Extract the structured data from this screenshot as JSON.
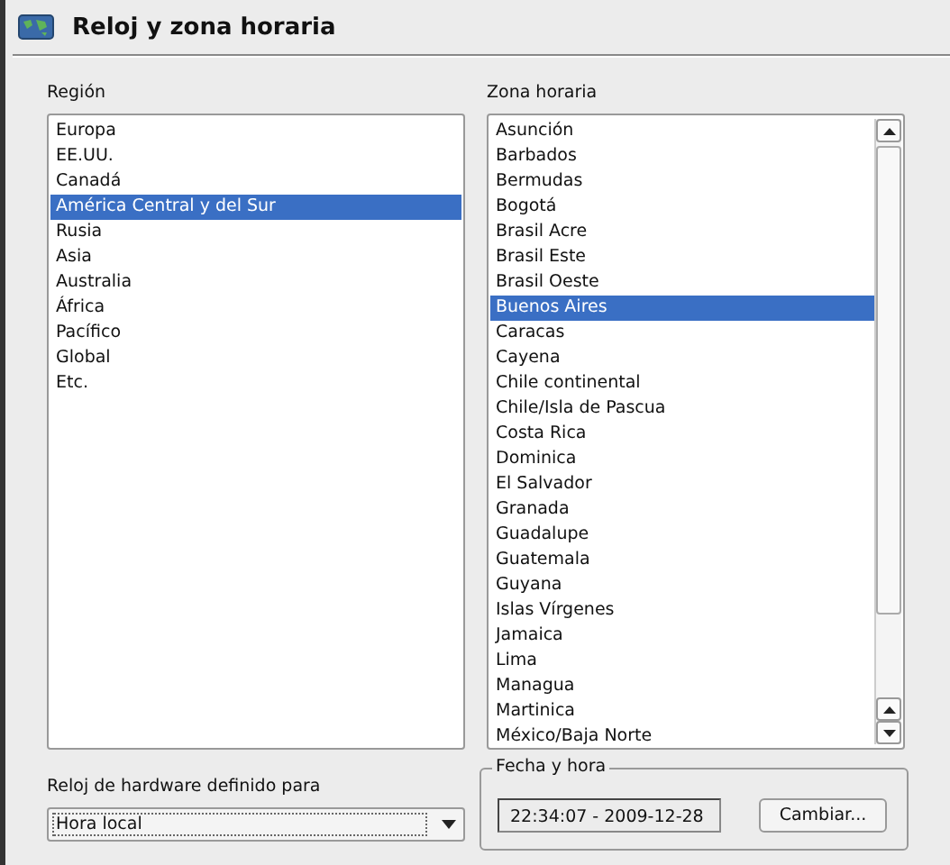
{
  "window": {
    "title": "Reloj y zona horaria"
  },
  "region": {
    "label": "Región",
    "items": [
      {
        "label": "Europa",
        "selected": false
      },
      {
        "label": "EE.UU.",
        "selected": false
      },
      {
        "label": "Canadá",
        "selected": false
      },
      {
        "label": "América Central y del Sur",
        "selected": true
      },
      {
        "label": "Rusia",
        "selected": false
      },
      {
        "label": "Asia",
        "selected": false
      },
      {
        "label": "Australia",
        "selected": false
      },
      {
        "label": "África",
        "selected": false
      },
      {
        "label": "Pacífico",
        "selected": false
      },
      {
        "label": "Global",
        "selected": false
      },
      {
        "label": "Etc.",
        "selected": false
      }
    ]
  },
  "timezone": {
    "label": "Zona horaria",
    "items": [
      {
        "label": "Asunción",
        "selected": false
      },
      {
        "label": "Barbados",
        "selected": false
      },
      {
        "label": "Bermudas",
        "selected": false
      },
      {
        "label": "Bogotá",
        "selected": false
      },
      {
        "label": "Brasil Acre",
        "selected": false
      },
      {
        "label": "Brasil Este",
        "selected": false
      },
      {
        "label": "Brasil Oeste",
        "selected": false
      },
      {
        "label": "Buenos Aires",
        "selected": true
      },
      {
        "label": "Caracas",
        "selected": false
      },
      {
        "label": "Cayena",
        "selected": false
      },
      {
        "label": "Chile continental",
        "selected": false
      },
      {
        "label": "Chile/Isla de Pascua",
        "selected": false
      },
      {
        "label": "Costa Rica",
        "selected": false
      },
      {
        "label": "Dominica",
        "selected": false
      },
      {
        "label": "El Salvador",
        "selected": false
      },
      {
        "label": "Granada",
        "selected": false
      },
      {
        "label": "Guadalupe",
        "selected": false
      },
      {
        "label": "Guatemala",
        "selected": false
      },
      {
        "label": "Guyana",
        "selected": false
      },
      {
        "label": "Islas Vírgenes",
        "selected": false
      },
      {
        "label": "Jamaica",
        "selected": false
      },
      {
        "label": "Lima",
        "selected": false
      },
      {
        "label": "Managua",
        "selected": false
      },
      {
        "label": "Martinica",
        "selected": false
      },
      {
        "label": "México/Baja Norte",
        "selected": false
      }
    ]
  },
  "hardware_clock": {
    "label": "Reloj de hardware definido para",
    "value": "Hora local"
  },
  "date_time": {
    "title": "Fecha y hora",
    "value": "22:34:07 - 2009-12-28",
    "button": "Cambiar..."
  }
}
